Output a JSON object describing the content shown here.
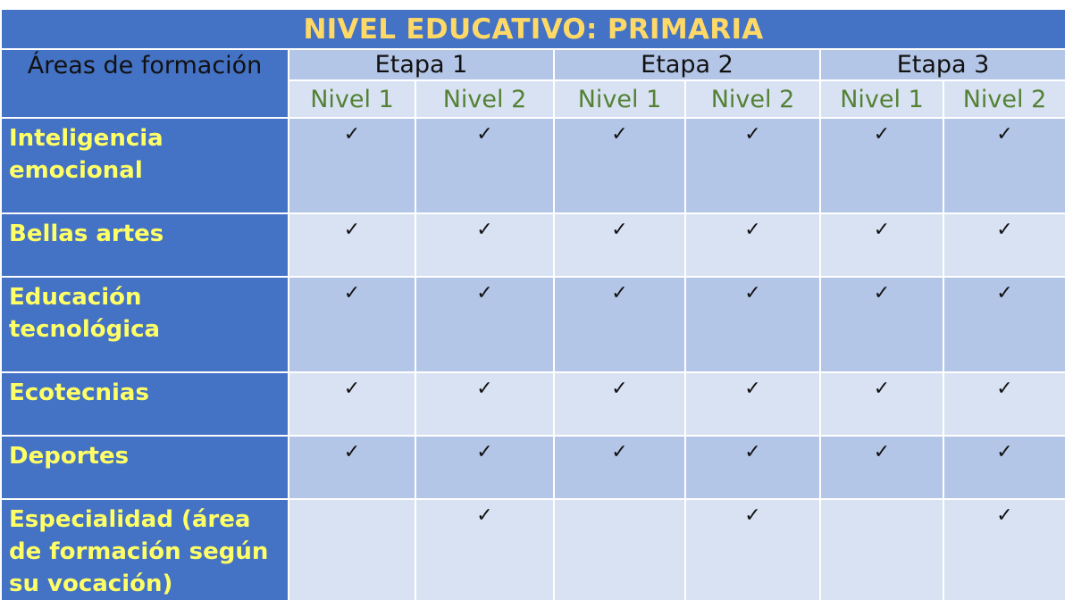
{
  "title": "NIVEL EDUCATIVO: PRIMARIA",
  "areas_header": "Áreas de formación",
  "etapas": [
    "Etapa 1",
    "Etapa 2",
    "Etapa 3"
  ],
  "niveles": [
    "Nivel 1",
    "Nivel 2",
    "Nivel 1",
    "Nivel 2",
    "Nivel 1",
    "Nivel 2"
  ],
  "check_symbol": "✓",
  "rows": [
    {
      "area": "Inteligencia emocional",
      "checks": [
        true,
        true,
        true,
        true,
        true,
        true
      ]
    },
    {
      "area": "Bellas artes",
      "checks": [
        true,
        true,
        true,
        true,
        true,
        true
      ]
    },
    {
      "area": "Educación tecnológica",
      "checks": [
        true,
        true,
        true,
        true,
        true,
        true
      ]
    },
    {
      "area": "Ecotecnias",
      "checks": [
        true,
        true,
        true,
        true,
        true,
        true
      ]
    },
    {
      "area": "Deportes",
      "checks": [
        true,
        true,
        true,
        true,
        true,
        true
      ]
    },
    {
      "area": "Especialidad (área de formación según su vocación)",
      "checks": [
        false,
        true,
        false,
        true,
        false,
        true
      ]
    }
  ],
  "colors": {
    "header_blue": "#4472c4",
    "title_text": "#ffd966",
    "area_text": "#ffff66",
    "cell_dark": "#b4c6e7",
    "cell_light": "#d9e2f3",
    "nivel_text": "#548235"
  }
}
